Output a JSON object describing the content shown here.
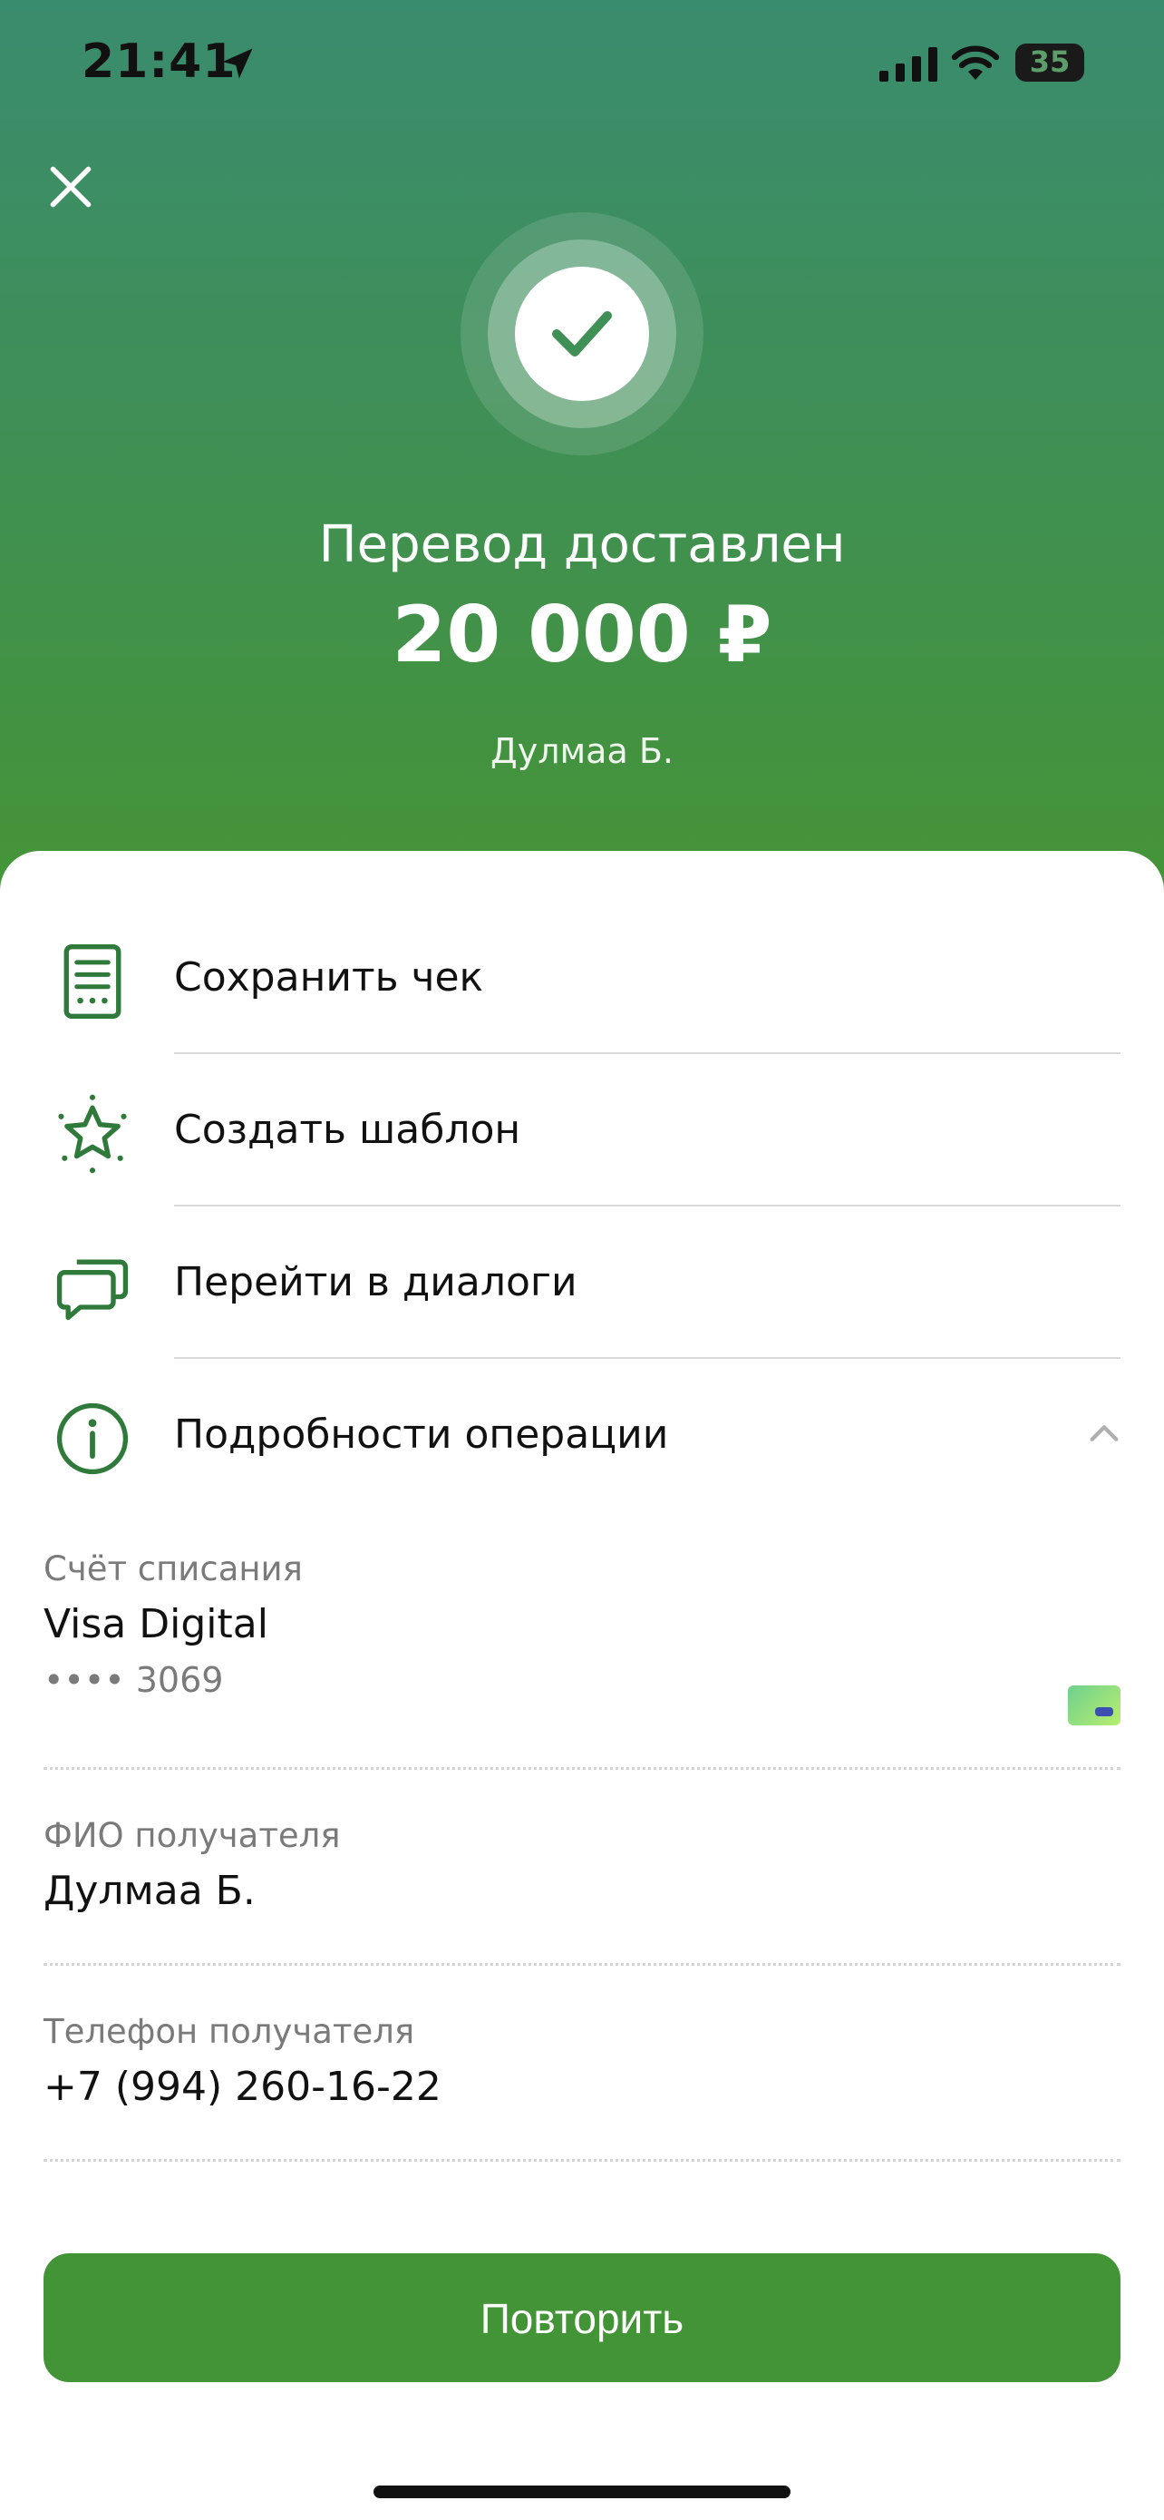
{
  "status_bar": {
    "time": "21:41",
    "battery": "35"
  },
  "hero": {
    "title": "Перевод доставлен",
    "amount": "20 000 ₽",
    "recipient": "Дулмаа Б."
  },
  "actions": [
    {
      "label": "Сохранить чек",
      "icon": "receipt-icon"
    },
    {
      "label": "Создать шаблон",
      "icon": "star-icon"
    },
    {
      "label": "Перейти в диалоги",
      "icon": "chat-icon"
    },
    {
      "label": "Подробности операции",
      "icon": "info-icon"
    }
  ],
  "details": {
    "account": {
      "caption": "Счёт списания",
      "value": "Visa Digital",
      "sub": "•••• 3069"
    },
    "name": {
      "caption": "ФИО получателя",
      "value": "Дулмаа Б."
    },
    "phone": {
      "caption": "Телефон получателя",
      "value": "+7 (994) 260-16-22"
    }
  },
  "repeat_button": "Повторить",
  "colors": {
    "primary": "#439436",
    "hero_top": "#3a8c6e",
    "icon_green": "#2f7a3a"
  }
}
